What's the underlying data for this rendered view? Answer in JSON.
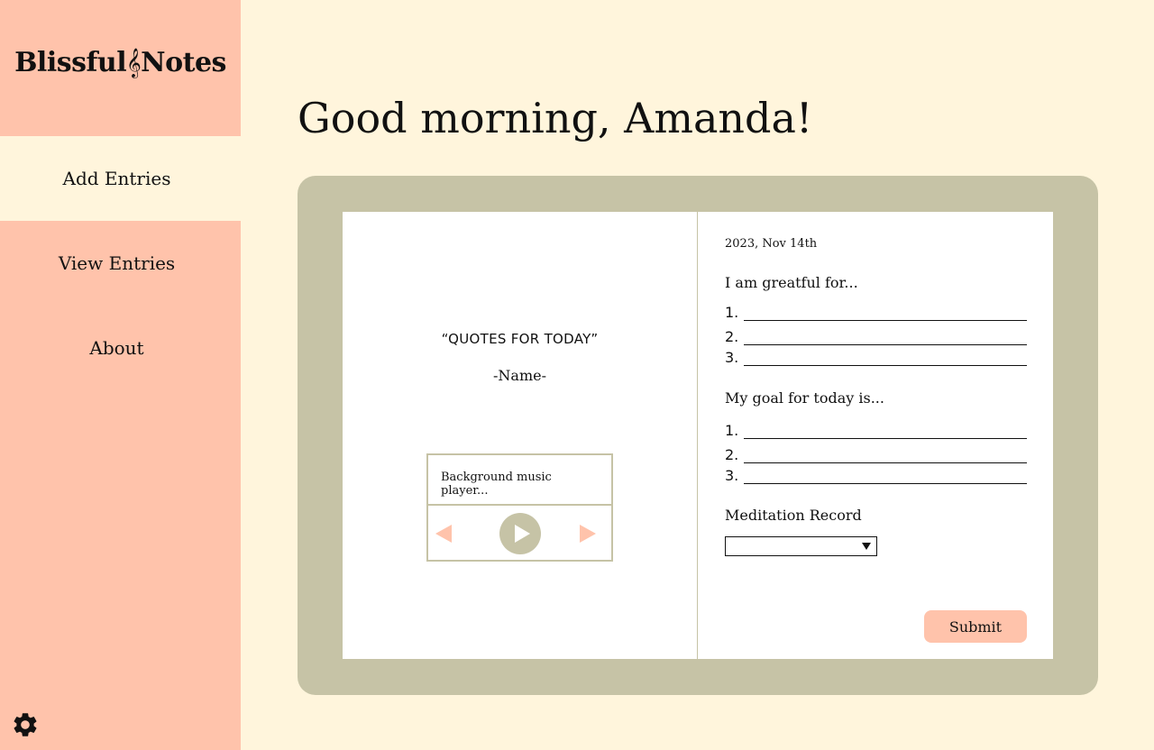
{
  "app": {
    "logo_left": "Blissful",
    "logo_clef": "𝄞",
    "logo_right": "Notes"
  },
  "sidebar": {
    "items": [
      {
        "label": "Add Entries",
        "active": true
      },
      {
        "label": "View Entries",
        "active": false
      },
      {
        "label": "About",
        "active": false
      }
    ],
    "settings_icon": "gear-icon"
  },
  "main": {
    "greeting": "Good morning, Amanda!"
  },
  "left_page": {
    "quote": "“QUOTES FOR TODAY”",
    "quote_author": "-Name-",
    "player": {
      "title": "Background music player...",
      "prev_icon": "previous-icon",
      "play_icon": "play-icon",
      "next_icon": "next-icon"
    }
  },
  "right_page": {
    "date": "2023, Nov 14th",
    "grateful_label": "I am greatful for...",
    "grateful_items": [
      "1.",
      "2.",
      "3."
    ],
    "goal_label": "My goal for today is...",
    "goal_items": [
      "1.",
      "2.",
      "3."
    ],
    "meditation_label": "Meditation Record",
    "meditation_value": "",
    "submit_label": "Submit"
  },
  "colors": {
    "background": "#fff5dc",
    "sidebar": "#ffc3ab",
    "book": "#c6c3a6",
    "accent": "#ffc3ab"
  }
}
